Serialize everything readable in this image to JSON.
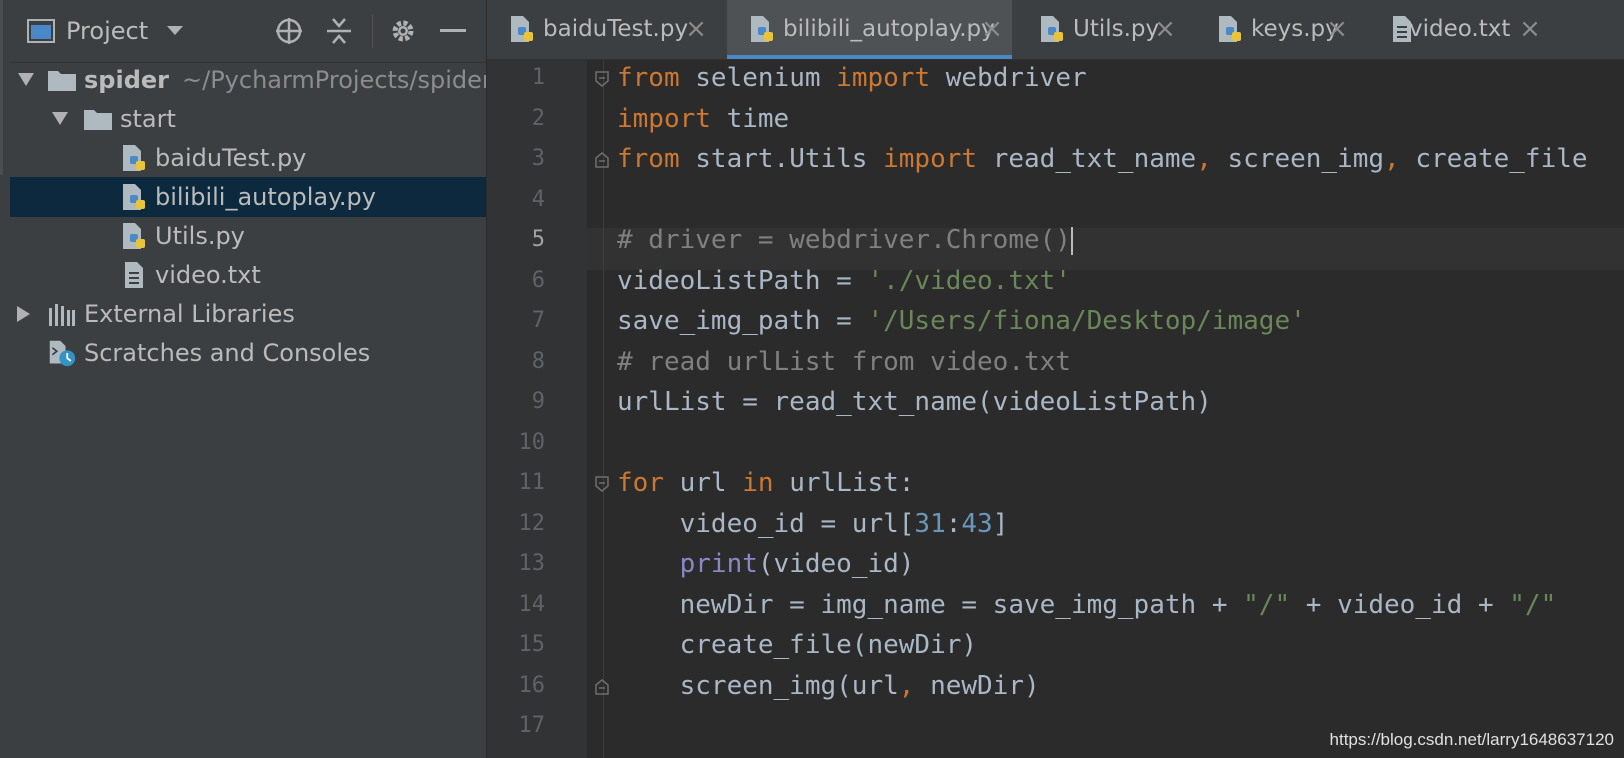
{
  "project_panel": {
    "title": "Project",
    "tree": [
      {
        "name": "spider",
        "hint": "~/PycharmProjects/spider",
        "type": "folder",
        "expanded": true
      },
      {
        "name": "start",
        "type": "folder",
        "expanded": true
      },
      {
        "name": "baiduTest.py",
        "type": "python"
      },
      {
        "name": "bilibili_autoplay.py",
        "type": "python",
        "selected": true
      },
      {
        "name": "Utils.py",
        "type": "python"
      },
      {
        "name": "video.txt",
        "type": "text"
      },
      {
        "name": "External Libraries",
        "type": "libraries",
        "expanded": false
      },
      {
        "name": "Scratches and Consoles",
        "type": "scratches"
      }
    ]
  },
  "tabs": [
    {
      "label": "baiduTest.py",
      "icon": "python-file-icon"
    },
    {
      "label": "bilibili_autoplay.py",
      "icon": "python-file-icon",
      "active": true
    },
    {
      "label": "Utils.py",
      "icon": "python-file-icon"
    },
    {
      "label": "keys.py",
      "icon": "python-file-icon"
    },
    {
      "label": "video.txt",
      "icon": "text-file-icon"
    }
  ],
  "editor": {
    "current_line": 5,
    "line_numbers": [
      "1",
      "2",
      "3",
      "4",
      "5",
      "6",
      "7",
      "8",
      "9",
      "10",
      "11",
      "12",
      "13",
      "14",
      "15",
      "16",
      "17"
    ],
    "lines": [
      [
        [
          "kw",
          "from"
        ],
        [
          "txt",
          " selenium "
        ],
        [
          "kw",
          "import"
        ],
        [
          "txt",
          " webdriver"
        ]
      ],
      [
        [
          "kw",
          "import"
        ],
        [
          "txt",
          " time"
        ]
      ],
      [
        [
          "kw",
          "from"
        ],
        [
          "txt",
          " start.Utils "
        ],
        [
          "kw",
          "import"
        ],
        [
          "txt",
          " read_txt_name"
        ],
        [
          "kw",
          ","
        ],
        [
          "txt",
          " screen_img"
        ],
        [
          "kw",
          ","
        ],
        [
          "txt",
          " create_file"
        ]
      ],
      [],
      [
        [
          "cm",
          "# driver = webdriver.Chrome()"
        ]
      ],
      [
        [
          "txt",
          "videoListPath = "
        ],
        [
          "str",
          "'./video.txt'"
        ]
      ],
      [
        [
          "txt",
          "save_img_path = "
        ],
        [
          "str",
          "'/Users/fiona/Desktop/image'"
        ]
      ],
      [
        [
          "cm",
          "# read urlList from video.txt"
        ]
      ],
      [
        [
          "txt",
          "urlList = read_txt_name(videoListPath)"
        ]
      ],
      [],
      [
        [
          "kw",
          "for"
        ],
        [
          "txt",
          " url "
        ],
        [
          "kw",
          "in"
        ],
        [
          "txt",
          " urlList:"
        ]
      ],
      [
        [
          "txt",
          "    video_id = url["
        ],
        [
          "num",
          "31"
        ],
        [
          "txt",
          ":"
        ],
        [
          "num",
          "43"
        ],
        [
          "txt",
          "]"
        ]
      ],
      [
        [
          "txt",
          "    "
        ],
        [
          "bi",
          "print"
        ],
        [
          "txt",
          "(video_id)"
        ]
      ],
      [
        [
          "txt",
          "    newDir = img_name = save_img_path + "
        ],
        [
          "str",
          "\"/\""
        ],
        [
          "txt",
          " + video_id + "
        ],
        [
          "str",
          "\"/\""
        ]
      ],
      [
        [
          "txt",
          "    create_file(newDir)"
        ]
      ],
      [
        [
          "txt",
          "    screen_img(url"
        ],
        [
          "kw",
          ","
        ],
        [
          "txt",
          " newDir)"
        ]
      ],
      []
    ]
  },
  "watermark": "https://blog.csdn.net/larry1648637120",
  "colors": {
    "panel_bg": "#3c3f41",
    "editor_bg": "#2b2b2b",
    "selection": "#0d293e",
    "active_tab_underline": "#4a88c7",
    "keyword": "#cc7832",
    "string": "#6a8759",
    "comment": "#808080",
    "number": "#6897bb"
  }
}
